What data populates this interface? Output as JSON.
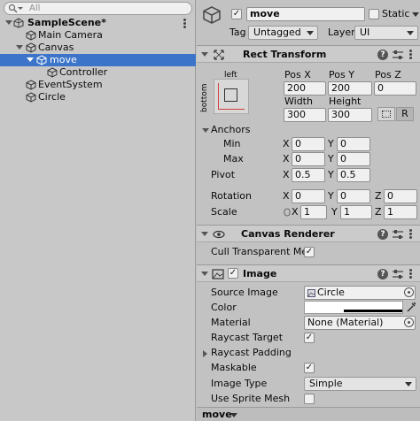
{
  "hierarchy": {
    "search_placeholder": "All",
    "scene": "SampleScene*",
    "items": [
      {
        "label": "Main Camera"
      },
      {
        "label": "Canvas"
      },
      {
        "label": "move"
      },
      {
        "label": "Controller"
      },
      {
        "label": "EventSystem"
      },
      {
        "label": "Circle"
      }
    ]
  },
  "inspector": {
    "object_name": "move",
    "active_checked": true,
    "static_label": "Static",
    "tag_label": "Tag",
    "tag_value": "Untagged",
    "layer_label": "Layer",
    "layer_value": "UI",
    "rect_transform": {
      "title": "Rect Transform",
      "anchor_left": "left",
      "anchor_bottom": "bottom",
      "pos_x_label": "Pos X",
      "pos_y_label": "Pos Y",
      "pos_z_label": "Pos Z",
      "pos_x": "200",
      "pos_y": "200",
      "pos_z": "0",
      "width_label": "Width",
      "height_label": "Height",
      "width": "300",
      "height": "300",
      "r_button": "R",
      "anchors_label": "Anchors",
      "min_label": "Min",
      "max_label": "Max",
      "min_x": "0",
      "min_y": "0",
      "max_x": "0",
      "max_y": "0",
      "pivot_label": "Pivot",
      "pivot_x": "0.5",
      "pivot_y": "0.5",
      "rotation_label": "Rotation",
      "rot_x": "0",
      "rot_y": "0",
      "rot_z": "0",
      "scale_label": "Scale",
      "scale_x": "1",
      "scale_y": "1",
      "scale_z": "1",
      "x": "X",
      "y": "Y",
      "z": "Z"
    },
    "canvas_renderer": {
      "title": "Canvas Renderer",
      "cull_label": "Cull Transparent Mes",
      "cull_checked": true
    },
    "image": {
      "title": "Image",
      "source_image_label": "Source Image",
      "source_image_value": "Circle",
      "color_label": "Color",
      "material_label": "Material",
      "material_value": "None (Material)",
      "raycast_target_label": "Raycast Target",
      "raycast_padding_label": "Raycast Padding",
      "maskable_label": "Maskable",
      "image_type_label": "Image Type",
      "image_type_value": "Simple",
      "use_sprite_mesh_label": "Use Sprite Mesh"
    },
    "bottom_label": "move"
  },
  "colors": {
    "selection": "#3b74c8",
    "panel": "#c2c2c2",
    "field": "#f0f0f0"
  }
}
